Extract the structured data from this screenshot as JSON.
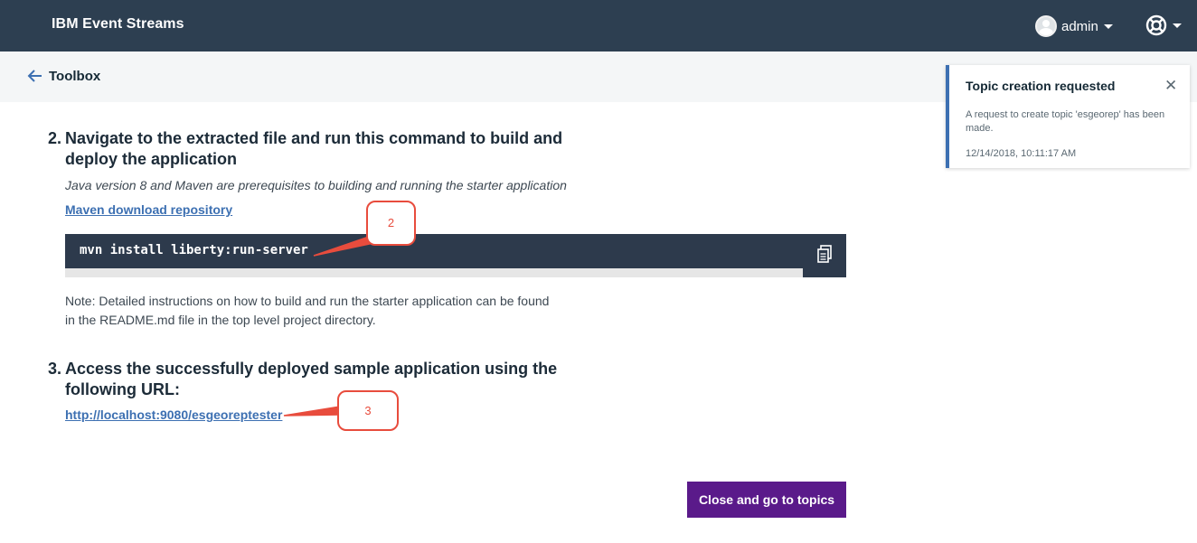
{
  "header": {
    "brand": "IBM Event Streams",
    "user_name": "admin",
    "icons": {
      "avatar": "user-avatar-icon",
      "help": "help-lifebuoy-icon",
      "caret": "chevron-down-icon"
    }
  },
  "subheader": {
    "back_label": "Toolbox",
    "back_icon": "arrow-left-icon"
  },
  "steps": [
    {
      "number": "2.",
      "title_line1": "Navigate to the extracted file and run this command to build and",
      "title_line2": "deploy the application",
      "prereq_note": "Java version 8 and Maven are prerequisites to building and running the starter application",
      "link_label": "Maven download repository",
      "code": "mvn install liberty:run-server",
      "copy_icon": "copy-icon",
      "note_line1": "Note: Detailed instructions on how to build and run the starter application can be found",
      "note_line2": "in the README.md file in the top level project directory."
    },
    {
      "number": "3.",
      "title_line1": "Access the successfully deployed sample application using the",
      "title_line2": "following URL:",
      "link_label": "http://localhost:9080/esgeoreptester"
    }
  ],
  "actions": {
    "primary_label": "Close and go to topics"
  },
  "notification": {
    "title": "Topic creation requested",
    "body": "A request to create topic 'esgeorep' has been made.",
    "timestamp": "12/14/2018, 10:11:17 AM",
    "close_icon": "close-icon",
    "accent_color": "#3d70b2"
  },
  "annotations": [
    {
      "label": "2"
    },
    {
      "label": "3"
    }
  ],
  "colors": {
    "header_bg": "#2d3f51",
    "code_bg": "#2d3a4c",
    "primary_button": "#5a1a8a",
    "link": "#3d70b2",
    "annotation": "#e84c3d"
  }
}
